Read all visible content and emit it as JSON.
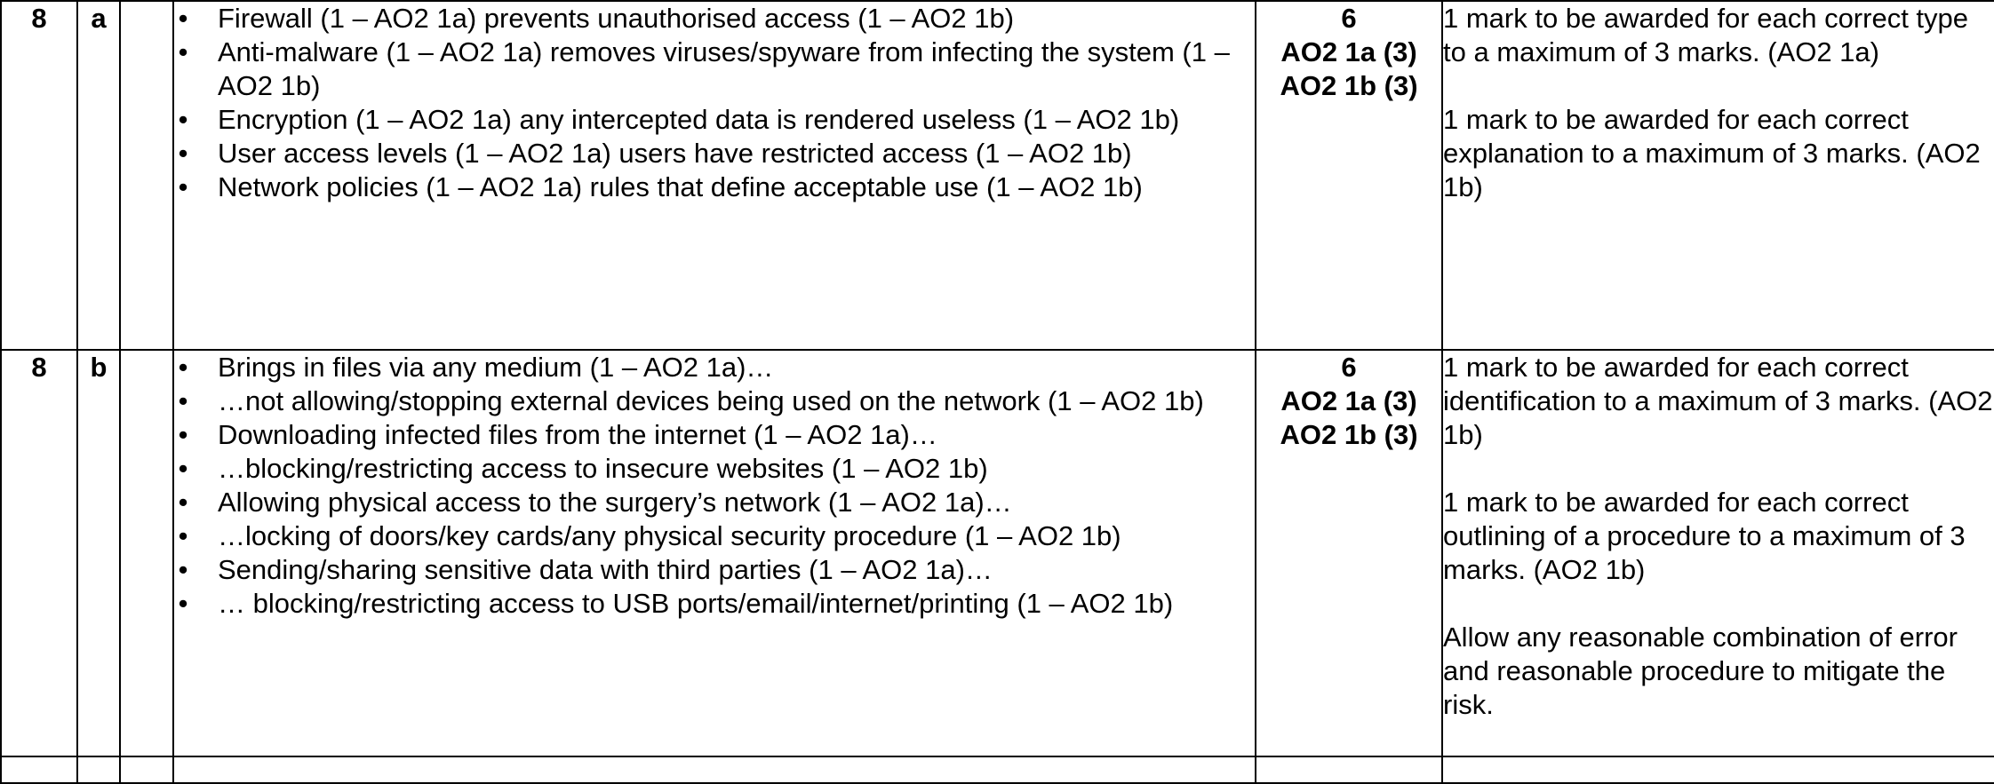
{
  "rows": [
    {
      "question": "8",
      "part": "a",
      "answers": [
        "Firewall (1 – AO2 1a) prevents unauthorised access (1 – AO2 1b)",
        "Anti-malware (1 – AO2 1a) removes viruses/spyware from infecting the system (1 – AO2 1b)",
        "Encryption (1 – AO2 1a) any intercepted data is rendered useless (1 – AO2 1b)",
        "User access levels (1 – AO2 1a) users have restricted access (1 – AO2 1b)",
        "Network policies (1 – AO2 1a) rules that define acceptable use (1 – AO2 1b)"
      ],
      "marks": [
        "6",
        "AO2 1a (3)",
        "AO2 1b (3)"
      ],
      "guidance": [
        "1 mark to be awarded for each correct type to a maximum of 3 marks. (AO2 1a)",
        "1 mark to be awarded for each correct explanation to a maximum of 3 marks. (AO2 1b)"
      ]
    },
    {
      "question": "8",
      "part": "b",
      "answers": [
        "Brings in files via any medium (1 – AO2 1a)…",
        "…not allowing/stopping external devices being used on the network (1 – AO2 1b)",
        " Downloading infected files from the internet (1 – AO2 1a)…",
        "…blocking/restricting access to insecure websites (1 – AO2 1b)",
        "Allowing physical access to the surgery’s network (1 – AO2 1a)…",
        "…locking of doors/key cards/any physical security procedure (1 – AO2 1b)",
        "Sending/sharing sensitive data with third parties (1 – AO2 1a)…",
        "… blocking/restricting access to USB ports/email/internet/printing (1 – AO2 1b)"
      ],
      "marks": [
        "6",
        "AO2 1a (3)",
        "AO2 1b (3)"
      ],
      "guidance": [
        "1 mark to be awarded for each correct identification to a maximum of 3 marks. (AO2 1b)",
        "1 mark to be awarded for each correct outlining of a procedure to a maximum of 3 marks. (AO2 1b)",
        "Allow any reasonable combination of error and reasonable procedure to mitigate the risk."
      ]
    }
  ],
  "bullet_glyph": "•"
}
